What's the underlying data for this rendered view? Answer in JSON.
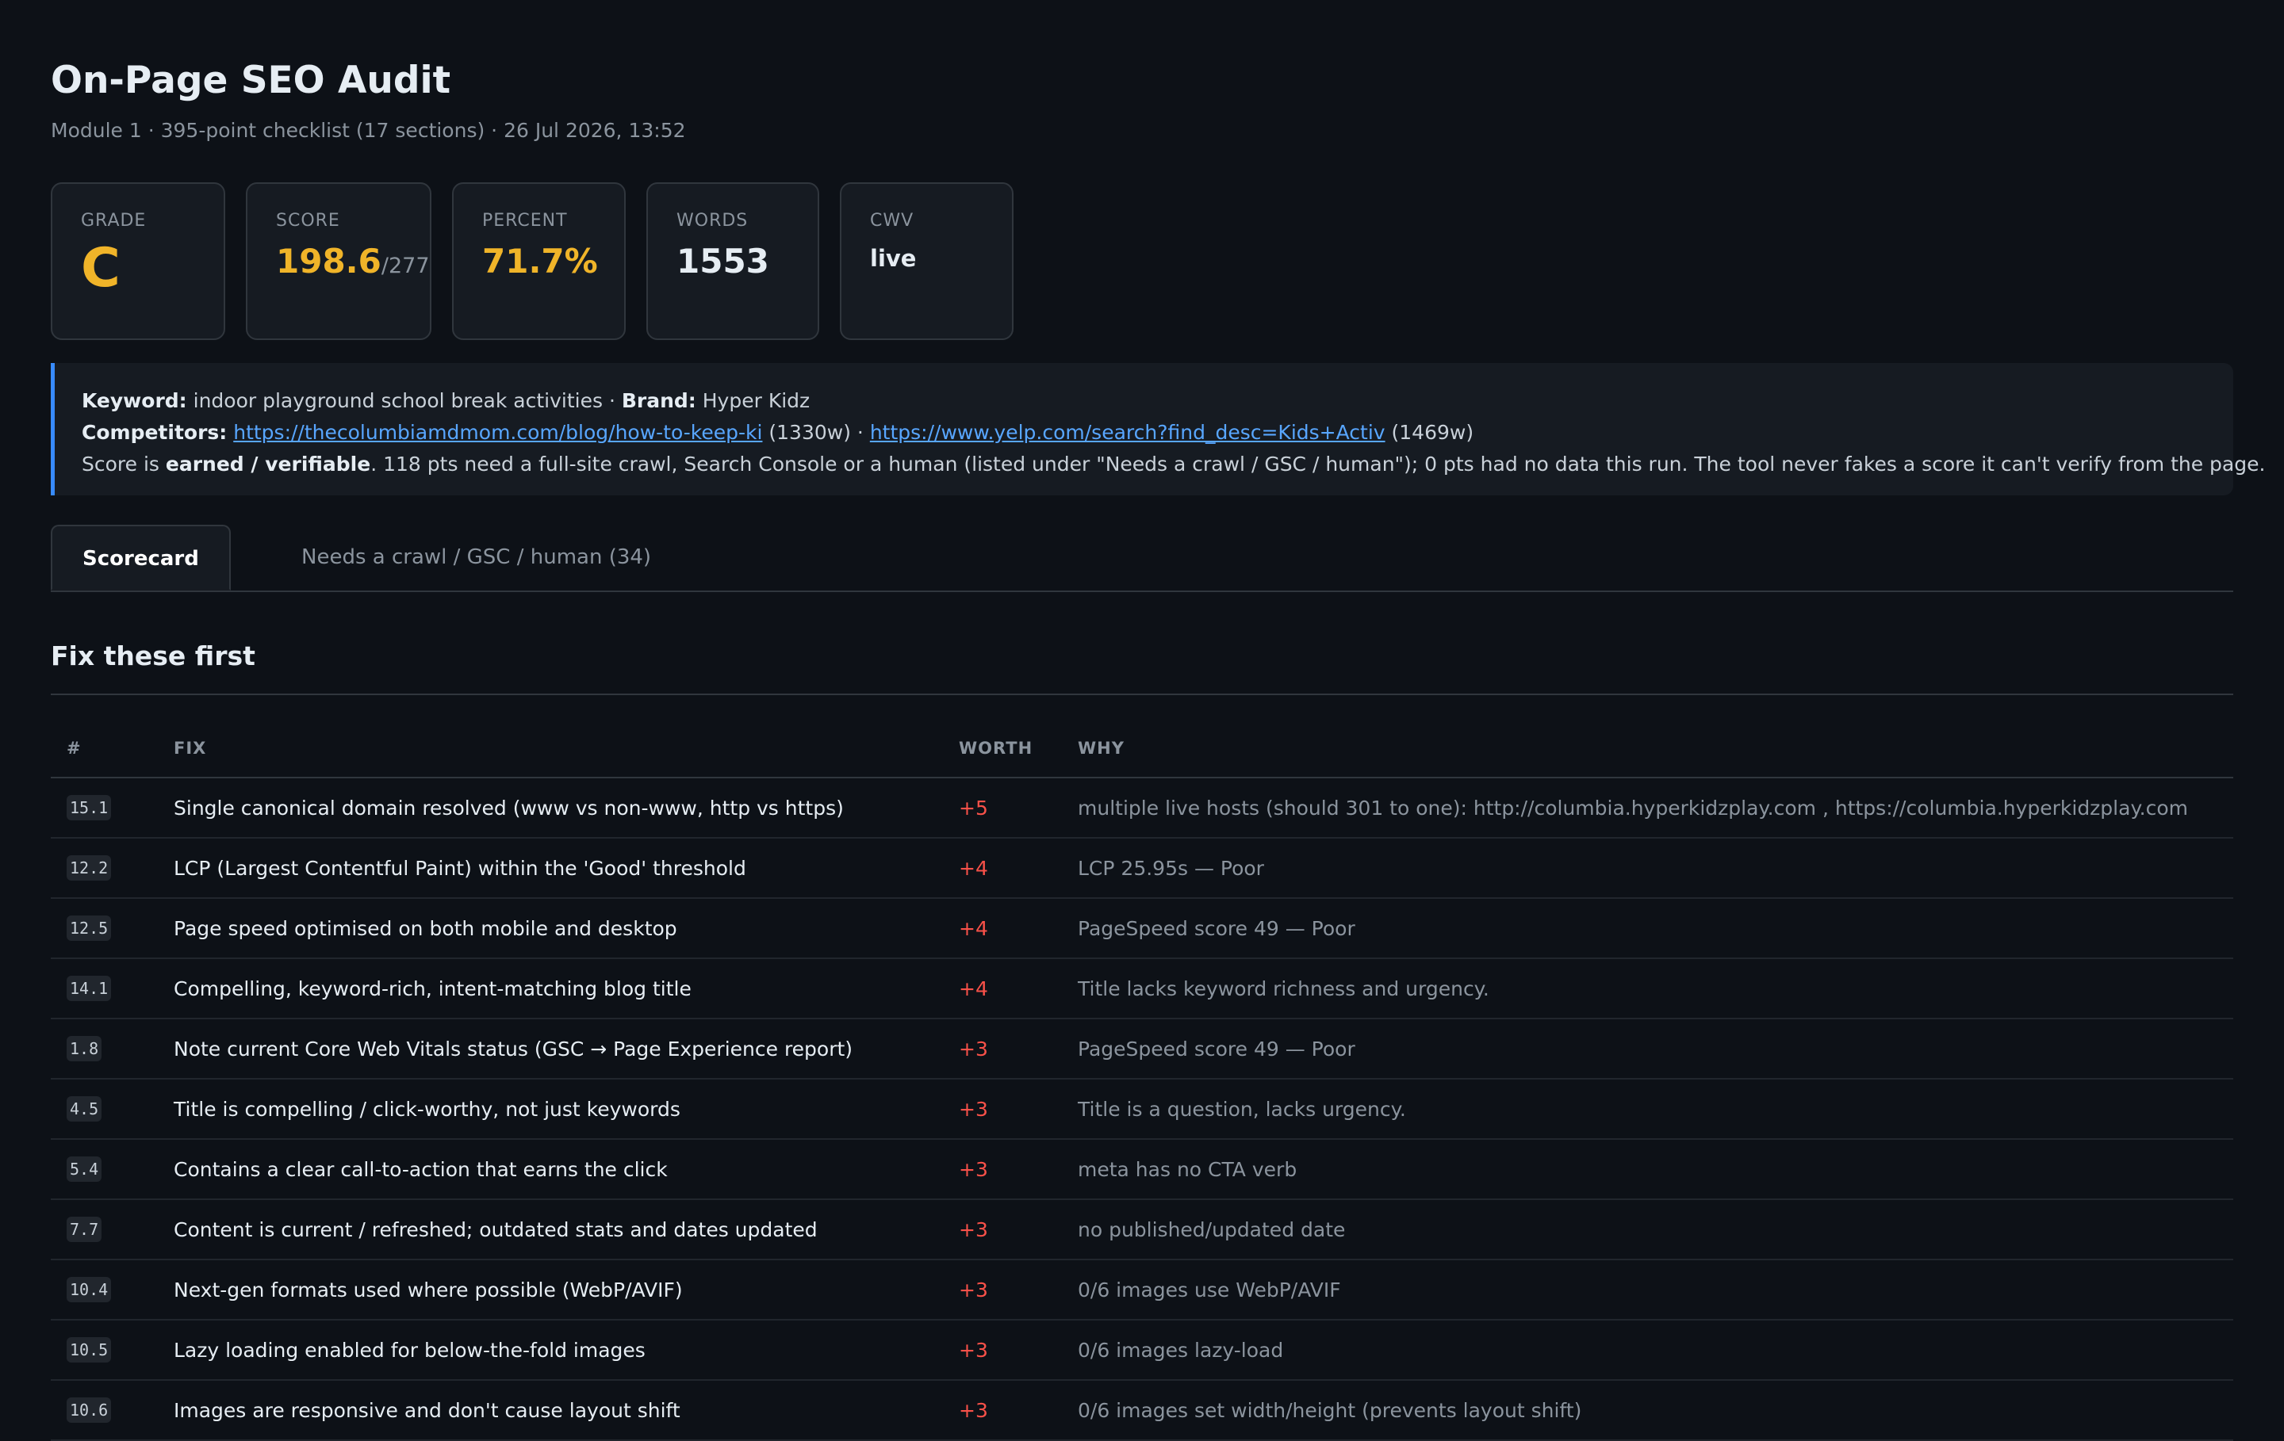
{
  "header": {
    "title": "On-Page SEO Audit",
    "subtitle": "Module 1 · 395-point checklist (17 sections) · 26 Jul 2026, 13:52"
  },
  "cards": {
    "grade": {
      "label": "GRADE",
      "value": "C"
    },
    "score": {
      "label": "SCORE",
      "value": "198.6",
      "outof": "/277"
    },
    "percent": {
      "label": "PERCENT",
      "value": "71.7%"
    },
    "words": {
      "label": "WORDS",
      "value": "1553"
    },
    "cwv": {
      "label": "CWV",
      "value": "live"
    }
  },
  "info": {
    "keyword_label": "Keyword:",
    "keyword": "indoor playground school break activities",
    "sep": "·",
    "brand_label": "Brand:",
    "brand": "Hyper Kidz",
    "competitors_label": "Competitors:",
    "competitor1_url": "https://thecolumbiamdmom.com/blog/how-to-keep-ki",
    "competitor1_words": "(1330w)",
    "competitor2_url": "https://www.yelp.com/search?find_desc=Kids+Activ",
    "competitor2_words": "(1469w)",
    "score_prefix": "Score is",
    "score_bold": "earned / verifiable",
    "score_text": ". 118 pts need a full-site crawl, Search Console or a human (listed under \"Needs a crawl / GSC / human\"); 0 pts had no data this run. The tool never fakes a score it can't verify from the page."
  },
  "tabs": [
    {
      "label": "Scorecard",
      "active": true
    },
    {
      "label": "Needs a crawl / GSC / human (34)",
      "active": false
    }
  ],
  "section": {
    "title": "Fix these first"
  },
  "table": {
    "columns": [
      "#",
      "FIX",
      "WORTH",
      "WHY"
    ],
    "rows": [
      {
        "id": "15.1",
        "fix": "Single canonical domain resolved (www vs non-www, http vs https)",
        "worth": "+5",
        "why": "multiple live hosts (should 301 to one): http://columbia.hyperkidzplay.com , https://columbia.hyperkidzplay.com"
      },
      {
        "id": "12.2",
        "fix": "LCP (Largest Contentful Paint) within the 'Good' threshold",
        "worth": "+4",
        "why": "LCP 25.95s — Poor"
      },
      {
        "id": "12.5",
        "fix": "Page speed optimised on both mobile and desktop",
        "worth": "+4",
        "why": "PageSpeed score 49 — Poor"
      },
      {
        "id": "14.1",
        "fix": "Compelling, keyword-rich, intent-matching blog title",
        "worth": "+4",
        "why": "Title lacks keyword richness and urgency."
      },
      {
        "id": "1.8",
        "fix": "Note current Core Web Vitals status (GSC → Page Experience report)",
        "worth": "+3",
        "why": "PageSpeed score 49 — Poor"
      },
      {
        "id": "4.5",
        "fix": "Title is compelling / click-worthy, not just keywords",
        "worth": "+3",
        "why": "Title is a question, lacks urgency."
      },
      {
        "id": "5.4",
        "fix": "Contains a clear call-to-action that earns the click",
        "worth": "+3",
        "why": "meta has no CTA verb"
      },
      {
        "id": "7.7",
        "fix": "Content is current / refreshed; outdated stats and dates updated",
        "worth": "+3",
        "why": "no published/updated date"
      },
      {
        "id": "10.4",
        "fix": "Next-gen formats used where possible (WebP/AVIF)",
        "worth": "+3",
        "why": "0/6 images use WebP/AVIF"
      },
      {
        "id": "10.5",
        "fix": "Lazy loading enabled for below-the-fold images",
        "worth": "+3",
        "why": "0/6 images lazy-load"
      },
      {
        "id": "10.6",
        "fix": "Images are responsive and don't cause layout shift",
        "worth": "+3",
        "why": "0/6 images set width/height (prevents layout shift)"
      }
    ]
  },
  "colors": {
    "background": "#0d1117",
    "card": "#161b22",
    "accent": "#f0b429",
    "link": "#58a6ff",
    "info_border": "#388bfd",
    "worth": "#f85149"
  }
}
